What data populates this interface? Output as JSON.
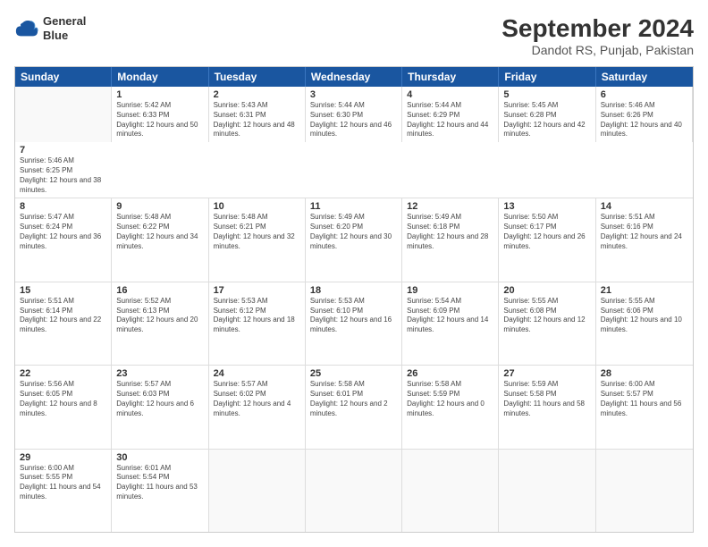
{
  "header": {
    "logo_line1": "General",
    "logo_line2": "Blue",
    "month": "September 2024",
    "location": "Dandot RS, Punjab, Pakistan"
  },
  "days": [
    "Sunday",
    "Monday",
    "Tuesday",
    "Wednesday",
    "Thursday",
    "Friday",
    "Saturday"
  ],
  "rows": [
    [
      {
        "day": "",
        "empty": true
      },
      {
        "day": "1",
        "rise": "5:42 AM",
        "set": "6:33 PM",
        "daylight": "12 hours and 50 minutes."
      },
      {
        "day": "2",
        "rise": "5:43 AM",
        "set": "6:31 PM",
        "daylight": "12 hours and 48 minutes."
      },
      {
        "day": "3",
        "rise": "5:44 AM",
        "set": "6:30 PM",
        "daylight": "12 hours and 46 minutes."
      },
      {
        "day": "4",
        "rise": "5:44 AM",
        "set": "6:29 PM",
        "daylight": "12 hours and 44 minutes."
      },
      {
        "day": "5",
        "rise": "5:45 AM",
        "set": "6:28 PM",
        "daylight": "12 hours and 42 minutes."
      },
      {
        "day": "6",
        "rise": "5:46 AM",
        "set": "6:26 PM",
        "daylight": "12 hours and 40 minutes."
      },
      {
        "day": "7",
        "rise": "5:46 AM",
        "set": "6:25 PM",
        "daylight": "12 hours and 38 minutes."
      }
    ],
    [
      {
        "day": "8",
        "rise": "5:47 AM",
        "set": "6:24 PM",
        "daylight": "12 hours and 36 minutes."
      },
      {
        "day": "9",
        "rise": "5:48 AM",
        "set": "6:22 PM",
        "daylight": "12 hours and 34 minutes."
      },
      {
        "day": "10",
        "rise": "5:48 AM",
        "set": "6:21 PM",
        "daylight": "12 hours and 32 minutes."
      },
      {
        "day": "11",
        "rise": "5:49 AM",
        "set": "6:20 PM",
        "daylight": "12 hours and 30 minutes."
      },
      {
        "day": "12",
        "rise": "5:49 AM",
        "set": "6:18 PM",
        "daylight": "12 hours and 28 minutes."
      },
      {
        "day": "13",
        "rise": "5:50 AM",
        "set": "6:17 PM",
        "daylight": "12 hours and 26 minutes."
      },
      {
        "day": "14",
        "rise": "5:51 AM",
        "set": "6:16 PM",
        "daylight": "12 hours and 24 minutes."
      }
    ],
    [
      {
        "day": "15",
        "rise": "5:51 AM",
        "set": "6:14 PM",
        "daylight": "12 hours and 22 minutes."
      },
      {
        "day": "16",
        "rise": "5:52 AM",
        "set": "6:13 PM",
        "daylight": "12 hours and 20 minutes."
      },
      {
        "day": "17",
        "rise": "5:53 AM",
        "set": "6:12 PM",
        "daylight": "12 hours and 18 minutes."
      },
      {
        "day": "18",
        "rise": "5:53 AM",
        "set": "6:10 PM",
        "daylight": "12 hours and 16 minutes."
      },
      {
        "day": "19",
        "rise": "5:54 AM",
        "set": "6:09 PM",
        "daylight": "12 hours and 14 minutes."
      },
      {
        "day": "20",
        "rise": "5:55 AM",
        "set": "6:08 PM",
        "daylight": "12 hours and 12 minutes."
      },
      {
        "day": "21",
        "rise": "5:55 AM",
        "set": "6:06 PM",
        "daylight": "12 hours and 10 minutes."
      }
    ],
    [
      {
        "day": "22",
        "rise": "5:56 AM",
        "set": "6:05 PM",
        "daylight": "12 hours and 8 minutes."
      },
      {
        "day": "23",
        "rise": "5:57 AM",
        "set": "6:03 PM",
        "daylight": "12 hours and 6 minutes."
      },
      {
        "day": "24",
        "rise": "5:57 AM",
        "set": "6:02 PM",
        "daylight": "12 hours and 4 minutes."
      },
      {
        "day": "25",
        "rise": "5:58 AM",
        "set": "6:01 PM",
        "daylight": "12 hours and 2 minutes."
      },
      {
        "day": "26",
        "rise": "5:58 AM",
        "set": "5:59 PM",
        "daylight": "12 hours and 0 minutes."
      },
      {
        "day": "27",
        "rise": "5:59 AM",
        "set": "5:58 PM",
        "daylight": "11 hours and 58 minutes."
      },
      {
        "day": "28",
        "rise": "6:00 AM",
        "set": "5:57 PM",
        "daylight": "11 hours and 56 minutes."
      }
    ],
    [
      {
        "day": "29",
        "rise": "6:00 AM",
        "set": "5:55 PM",
        "daylight": "11 hours and 54 minutes."
      },
      {
        "day": "30",
        "rise": "6:01 AM",
        "set": "5:54 PM",
        "daylight": "11 hours and 53 minutes."
      },
      {
        "day": "",
        "empty": true
      },
      {
        "day": "",
        "empty": true
      },
      {
        "day": "",
        "empty": true
      },
      {
        "day": "",
        "empty": true
      },
      {
        "day": "",
        "empty": true
      }
    ]
  ]
}
